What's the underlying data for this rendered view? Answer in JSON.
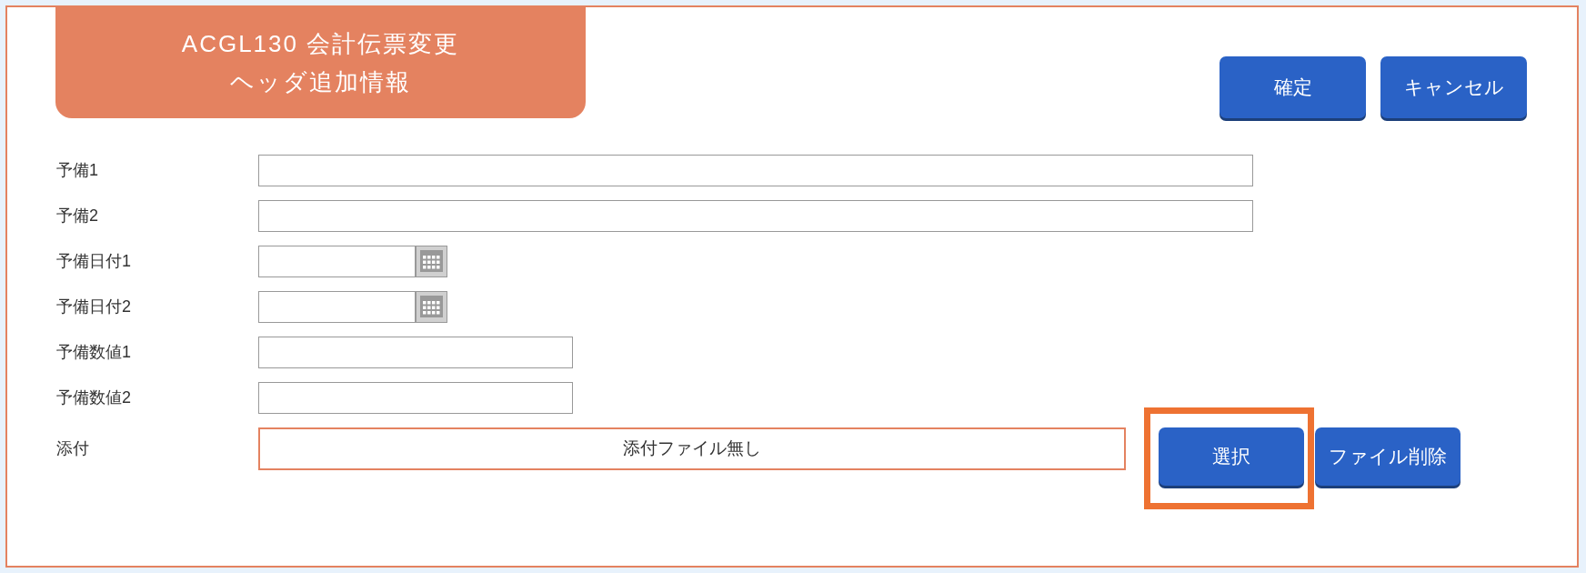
{
  "title": {
    "line1": "ACGL130 会計伝票変更",
    "line2": "ヘッダ追加情報"
  },
  "header_buttons": [
    {
      "label": "確定"
    },
    {
      "label": "キャンセル"
    }
  ],
  "fields": [
    {
      "label": "予備1",
      "kind": "text"
    },
    {
      "label": "予備2",
      "kind": "text"
    },
    {
      "label": "予備日付1",
      "kind": "date"
    },
    {
      "label": "予備日付2",
      "kind": "date"
    },
    {
      "label": "予備数値1",
      "kind": "number"
    },
    {
      "label": "予備数値2",
      "kind": "number"
    }
  ],
  "attachment": {
    "label": "添付",
    "value": "添付ファイル無し",
    "buttons": [
      {
        "label": "選択",
        "highlighted": true
      },
      {
        "label": "ファイル削除",
        "highlighted": false
      }
    ]
  }
}
